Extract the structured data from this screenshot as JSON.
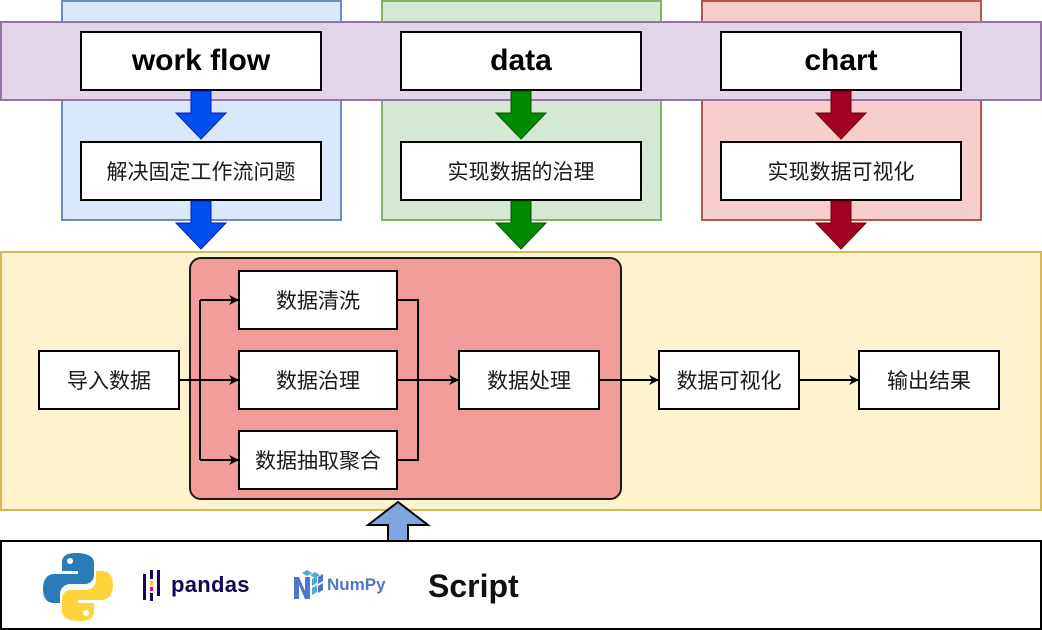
{
  "lanes": [
    {
      "title": "work flow",
      "description": "解决固定工作流问题",
      "color": "#dae8fc",
      "border": "#6c8ebf",
      "arrow_color": "#0050ef"
    },
    {
      "title": "data",
      "description": "实现数据的治理",
      "color": "#d5e8d4",
      "border": "#82b366",
      "arrow_color": "#008a00"
    },
    {
      "title": "chart",
      "description": "实现数据可视化",
      "color": "#f8cecc",
      "border": "#b85450",
      "arrow_color": "#a20025"
    }
  ],
  "band_color": "#e1d5e7",
  "process": {
    "background": "#fff2cc",
    "import": "导入数据",
    "processing_group": {
      "background": "#f19c99",
      "steps": [
        "数据清洗",
        "数据治理",
        "数据抽取聚合"
      ],
      "output": "数据处理"
    },
    "visualize": "数据可视化",
    "result": "输出结果"
  },
  "footer": {
    "logos": [
      {
        "name": "python-logo",
        "label": ""
      },
      {
        "name": "pandas-logo",
        "label": "pandas"
      },
      {
        "name": "numpy-logo",
        "label": "NumPy"
      }
    ],
    "script_label": "Script",
    "arrow_color": "#7ea6e0"
  }
}
